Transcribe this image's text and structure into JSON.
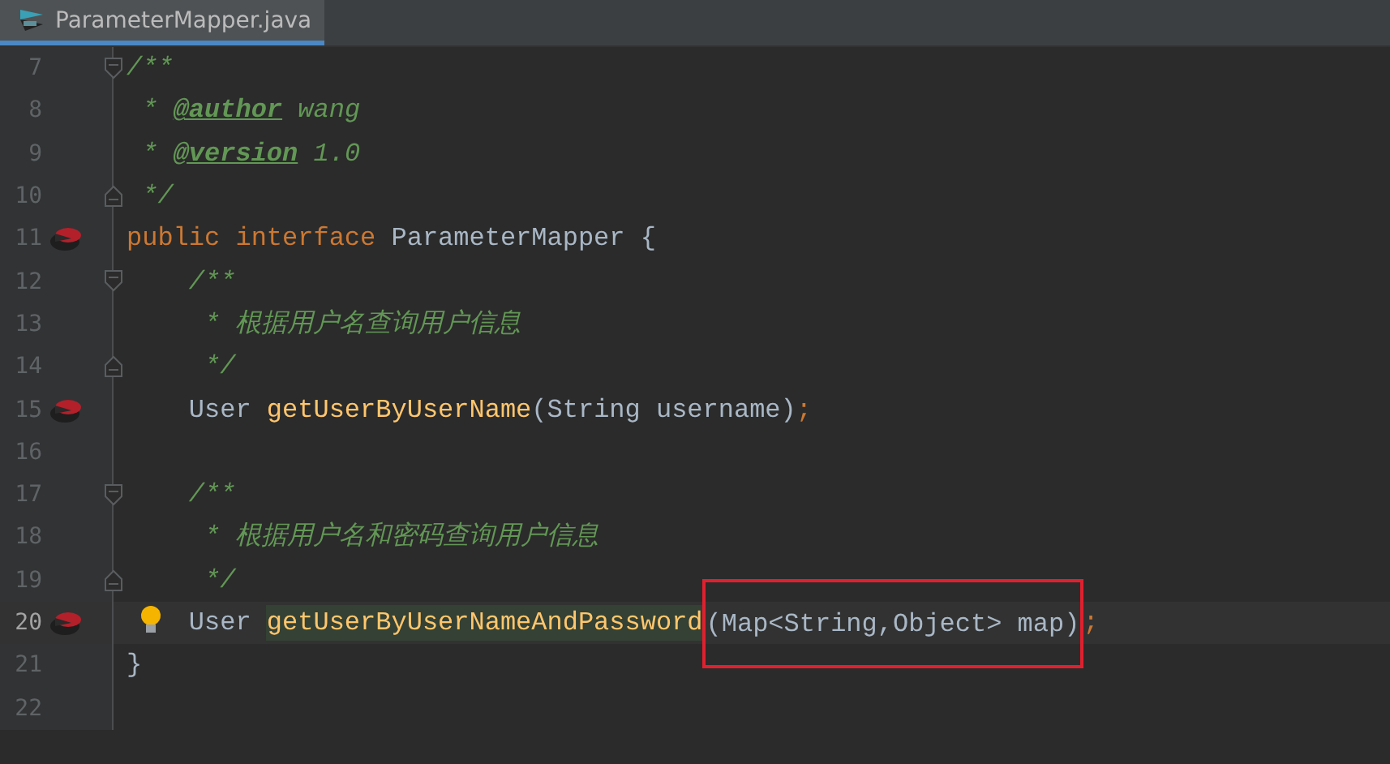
{
  "tabs": [
    {
      "label": "ParameterMapper.java",
      "selected": true
    }
  ],
  "lines": [
    {
      "number": "7",
      "current": false,
      "fold_start": true,
      "tokens": [
        {
          "kind": "comment",
          "text": "/**"
        }
      ]
    },
    {
      "number": "8",
      "current": false,
      "tokens": [
        {
          "kind": "comment",
          "text": " * "
        },
        {
          "kind": "tag",
          "text": "@author"
        },
        {
          "kind": "comment",
          "text": " wang"
        }
      ]
    },
    {
      "number": "9",
      "current": false,
      "tokens": [
        {
          "kind": "comment",
          "text": " * "
        },
        {
          "kind": "tag",
          "text": "@version"
        },
        {
          "kind": "comment",
          "text": " 1.0"
        }
      ]
    },
    {
      "number": "10",
      "current": false,
      "fold_end": true,
      "tokens": [
        {
          "kind": "comment",
          "text": " */"
        }
      ]
    },
    {
      "number": "11",
      "current": false,
      "mapper_marker": true,
      "tokens": [
        {
          "kind": "keyword",
          "text": "public interface "
        },
        {
          "kind": "plain",
          "text": "ParameterMapper {"
        }
      ]
    },
    {
      "number": "12",
      "current": false,
      "fold_start": true,
      "tokens": [
        {
          "kind": "comment",
          "text": "    /**"
        }
      ]
    },
    {
      "number": "13",
      "current": false,
      "tokens": [
        {
          "kind": "comment",
          "text": "     * 根据用户名查询用户信息"
        }
      ]
    },
    {
      "number": "14",
      "current": false,
      "fold_end": true,
      "tokens": [
        {
          "kind": "comment",
          "text": "     */"
        }
      ]
    },
    {
      "number": "15",
      "current": false,
      "mapper_marker": true,
      "tokens": [
        {
          "kind": "plain",
          "text": "    User "
        },
        {
          "kind": "method",
          "text": "getUserByUserName"
        },
        {
          "kind": "plain",
          "text": "(String username)"
        },
        {
          "kind": "keyword",
          "text": ";"
        }
      ]
    },
    {
      "number": "16",
      "current": false
    },
    {
      "number": "17",
      "current": false,
      "fold_start": true,
      "tokens": [
        {
          "kind": "comment",
          "text": "    /**"
        }
      ]
    },
    {
      "number": "18",
      "current": false,
      "tokens": [
        {
          "kind": "comment",
          "text": "     * 根据用户名和密码查询用户信息"
        }
      ]
    },
    {
      "number": "19",
      "current": false,
      "fold_end": true,
      "tokens": [
        {
          "kind": "comment",
          "text": "     */"
        }
      ]
    },
    {
      "number": "20",
      "current": true,
      "mapper_marker": true,
      "intention_bulb": true,
      "tokens": [
        {
          "kind": "plain",
          "text": "    User "
        },
        {
          "kind": "method",
          "text": "getUserByUserNameAndPassword",
          "highlighted": true
        },
        {
          "kind": "plain",
          "text": "(Map<String,Object> map)",
          "boxed": true
        },
        {
          "kind": "keyword",
          "text": ";"
        }
      ]
    },
    {
      "number": "21",
      "current": false,
      "tokens": [
        {
          "kind": "plain",
          "text": "}"
        }
      ]
    },
    {
      "number": "22",
      "current": false
    }
  ]
}
